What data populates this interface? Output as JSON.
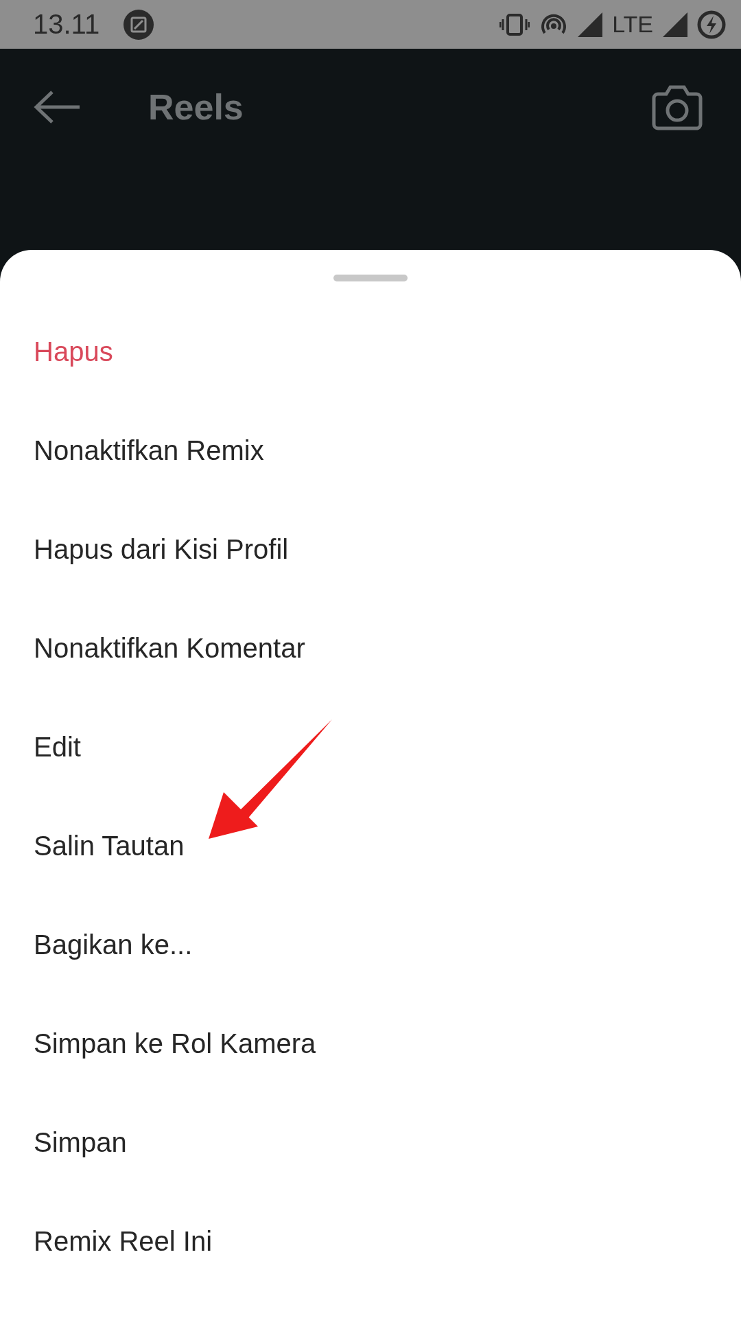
{
  "status_bar": {
    "time": "13.11",
    "network": "LTE"
  },
  "header": {
    "title": "Reels"
  },
  "menu": [
    {
      "label": "Hapus",
      "kind": "destructive"
    },
    {
      "label": "Nonaktifkan Remix",
      "kind": "normal"
    },
    {
      "label": "Hapus dari Kisi Profil",
      "kind": "normal"
    },
    {
      "label": "Nonaktifkan Komentar",
      "kind": "normal"
    },
    {
      "label": "Edit",
      "kind": "normal"
    },
    {
      "label": "Salin Tautan",
      "kind": "normal"
    },
    {
      "label": "Bagikan ke...",
      "kind": "normal"
    },
    {
      "label": "Simpan ke Rol Kamera",
      "kind": "normal"
    },
    {
      "label": "Simpan",
      "kind": "normal"
    },
    {
      "label": "Remix Reel Ini",
      "kind": "normal"
    }
  ]
}
